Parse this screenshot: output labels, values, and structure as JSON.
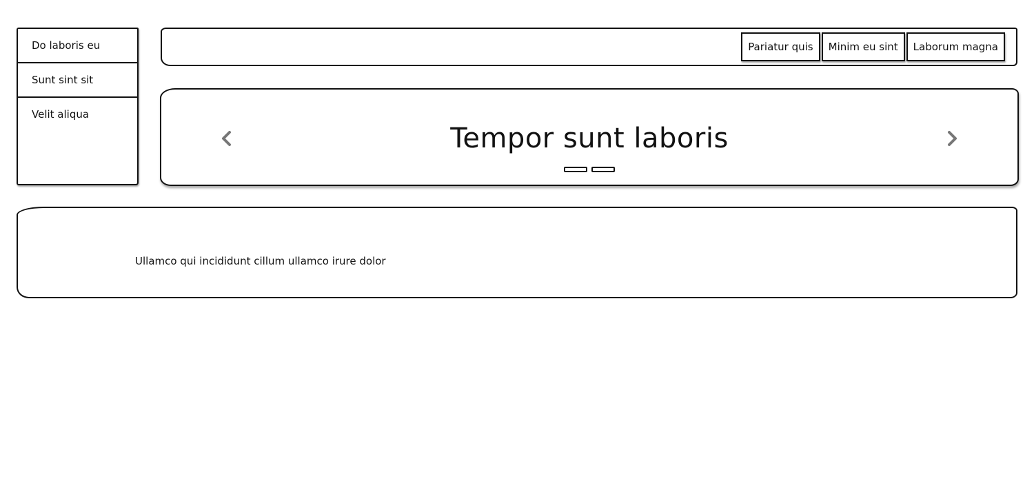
{
  "side_menu": {
    "items": [
      {
        "label": "Do laboris eu"
      },
      {
        "label": "Sunt sint sit"
      },
      {
        "label": "Velit aliqua"
      }
    ]
  },
  "toolbar": {
    "buttons": [
      {
        "label": "Pariatur quis"
      },
      {
        "label": "Minim eu sint"
      },
      {
        "label": "Laborum magna"
      }
    ]
  },
  "carousel": {
    "title": "Tempor sunt laboris",
    "prev_icon": "chevron-left-icon",
    "next_icon": "chevron-right-icon",
    "slide_count": 2,
    "active_slide": 1
  },
  "content": {
    "text": "Ullamco qui incididunt cillum ullamco irure dolor"
  },
  "colors": {
    "border": "#111111",
    "arrow": "#777777",
    "background": "#ffffff"
  }
}
